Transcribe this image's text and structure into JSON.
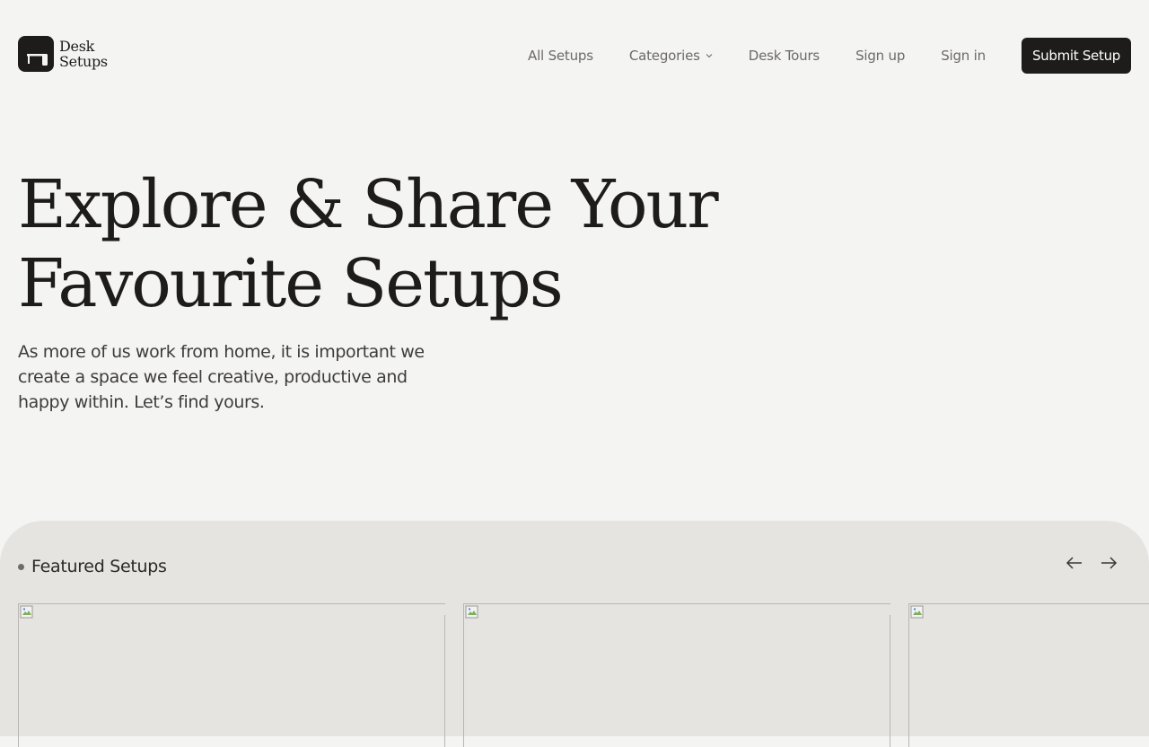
{
  "logo": {
    "line1": "Desk",
    "line2": "Setups"
  },
  "nav": {
    "items": [
      "All Setups",
      "Categories",
      "Desk Tours",
      "Sign up",
      "Sign in"
    ],
    "submit_label": "Submit Setup"
  },
  "hero": {
    "title_line1": "Explore & Share Your",
    "title_line2": "Favourite Setups",
    "subtitle": "As more of us work from home, it is important we create a space we feel creative, productive and happy within. Let’s find yours."
  },
  "featured": {
    "title": "Featured Setups",
    "prev_icon": "arrow-left-icon",
    "next_icon": "arrow-right-icon"
  },
  "colors": {
    "background": "#f4f4f3",
    "section": "#e6e4e1",
    "button": "#1d1c1b"
  }
}
